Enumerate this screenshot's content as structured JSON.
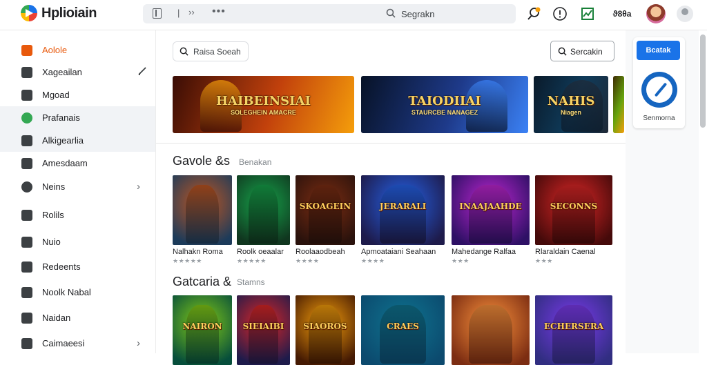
{
  "app": {
    "title": "Hplioiain"
  },
  "topbar": {
    "search_sep": "|",
    "search_chevron": "››",
    "search_dots": "•••",
    "search_placeholder": "Segrakn",
    "icons": [
      "search-icon",
      "alert-icon",
      "info-icon",
      "chart-icon",
      "text-icon",
      "avatar",
      "user-icon"
    ],
    "text_icon": "ϑ8θa"
  },
  "sidebar": {
    "items": [
      {
        "label": "Aolole",
        "icon": "grid-icon",
        "color": "#e8590c",
        "active": false,
        "accent": true
      },
      {
        "label": "Xageailan",
        "icon": "image-icon",
        "color": "#3c4043",
        "active": false,
        "trail": "pencil-icon"
      },
      {
        "label": "Mgoad",
        "icon": "box-icon",
        "color": "#3c4043",
        "active": false
      },
      {
        "label": "Prafanais",
        "icon": "check-circle-icon",
        "color": "#34a853",
        "active": true
      },
      {
        "label": "Alkigearlia",
        "icon": "monitor-icon",
        "color": "#3c4043",
        "active": true
      },
      {
        "label": "Amesdaam",
        "icon": "home-icon",
        "color": "#3c4043",
        "active": false
      },
      {
        "label": "Neins",
        "icon": "search-icon",
        "color": "#3c4043",
        "active": false,
        "trail": "›"
      },
      {
        "label": "Rolils",
        "icon": "folder-icon",
        "color": "#3c4043",
        "active": false
      },
      {
        "label": "Nuio",
        "icon": "mail-icon",
        "color": "#3c4043",
        "active": false
      },
      {
        "label": "Redeents",
        "icon": "document-icon",
        "color": "#3c4043",
        "active": false
      },
      {
        "label": "Noolk Nabal",
        "icon": "archive-icon",
        "color": "#3c4043",
        "active": false
      },
      {
        "label": "Naidan",
        "icon": "camera-icon",
        "color": "#3c4043",
        "active": false
      },
      {
        "label": "Caimaeesi",
        "icon": "gear-icon",
        "color": "#3c4043",
        "active": false,
        "trail": "›"
      }
    ]
  },
  "main": {
    "search_pill": "Raisa Soeah",
    "search_button": "Sercakin",
    "banners": [
      {
        "title": "HAIBEINSIAI",
        "sub": "SOLEGHEIN AMACRE",
        "colors": [
          "#3a0d05",
          "#c2410c",
          "#f59e0b"
        ]
      },
      {
        "title": "TAIODIIAI",
        "sub": "STAURCBE NANAGEZ",
        "colors": [
          "#071226",
          "#1e3a8a",
          "#3b82f6"
        ]
      },
      {
        "title": "NAHIS",
        "sub": "Niagen",
        "colors": [
          "#0a1a2a",
          "#0f3b5a",
          "#1f2937"
        ]
      },
      {
        "title": "",
        "sub": "",
        "colors": [
          "#3f2b04",
          "#65a30d",
          "#f59e0b"
        ]
      }
    ],
    "section1": {
      "title": "Gavole &s",
      "sub": "Benakan"
    },
    "section2": {
      "title": "Gatcaria &",
      "sub": "Stamns"
    },
    "row1": [
      {
        "title": "Nalhakn Roma",
        "stars": "★★★★★",
        "label": "",
        "colors": [
          "#1c3b5a",
          "#c05621"
        ]
      },
      {
        "title": "Roolk oeaalar",
        "stars": "★★★★★",
        "label": "",
        "colors": [
          "#10361f",
          "#16a34a"
        ]
      },
      {
        "title": "Roolaaodbeah",
        "stars": "★★★★",
        "label": "SKOAGEIN",
        "colors": [
          "#2a120c",
          "#7c2d12"
        ]
      },
      {
        "title": "Apmoataiani Seahaan",
        "stars": "★★★★",
        "label": "JERARALI",
        "colors": [
          "#1e1b4b",
          "#2563eb"
        ]
      },
      {
        "title": "Mahedange Ralfaa",
        "stars": "★★★",
        "label": "INAAJAAHDE",
        "colors": [
          "#2e1065",
          "#c026d3"
        ]
      },
      {
        "title": "Rlaraldain Caenal",
        "stars": "★★★",
        "label": "SECONNS",
        "colors": [
          "#450a0a",
          "#dc2626"
        ]
      }
    ],
    "row2": [
      {
        "label": "NAIRON",
        "colors": [
          "#064e3b",
          "#84cc16"
        ]
      },
      {
        "label": "SIEIAIBI",
        "colors": [
          "#1e1b4b",
          "#dc2626"
        ]
      },
      {
        "label": "SIAOROS",
        "colors": [
          "#451a03",
          "#f59e0b"
        ]
      },
      {
        "label": "CRAES",
        "colors": [
          "#0c4a6e",
          "#0e7490"
        ]
      },
      {
        "label": "",
        "colors": [
          "#7c2d12",
          "#fb923c"
        ]
      },
      {
        "label": "ECHERSERA",
        "colors": [
          "#312e81",
          "#7c3aed"
        ]
      }
    ]
  },
  "right_panel": {
    "button": "Bcatak",
    "logo": "compass-icon",
    "label": "Senmorna"
  }
}
